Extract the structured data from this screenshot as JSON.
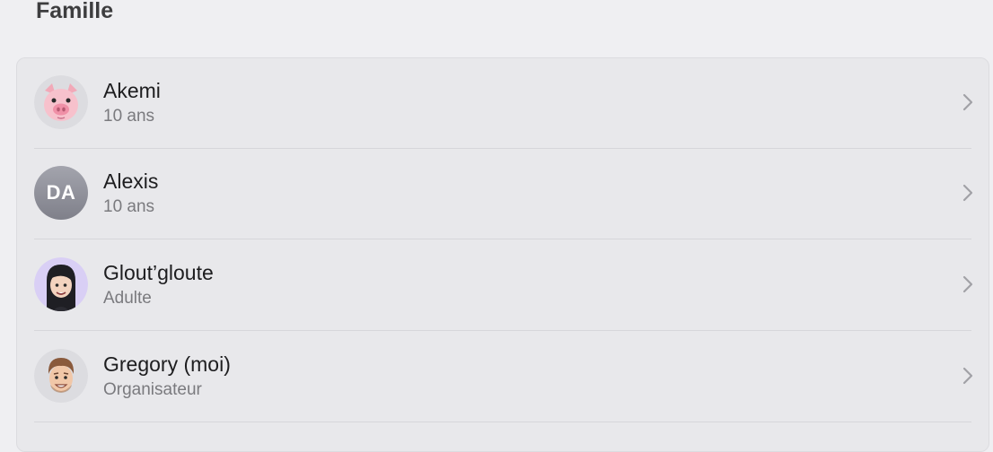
{
  "section": {
    "title": "Famille"
  },
  "members": [
    {
      "name": "Akemi",
      "subtitle": "10 ans",
      "avatar": "pig-memoji-icon"
    },
    {
      "name": "Alexis",
      "subtitle": "10 ans",
      "avatar": "initials",
      "initials": "DA"
    },
    {
      "name": "Glout’gloute",
      "subtitle": "Adulte",
      "avatar": "woman-memoji-icon"
    },
    {
      "name": "Gregory (moi)",
      "subtitle": "Organisateur",
      "avatar": "man-memoji-icon"
    }
  ],
  "icons": {
    "row_chevron": "chevron-right-icon"
  },
  "colors": {
    "background": "#efeff2",
    "card": "#e8e8eb",
    "text_primary": "#1d1d1f",
    "text_secondary": "#7a7a7e",
    "chevron": "#a1a1a6"
  }
}
